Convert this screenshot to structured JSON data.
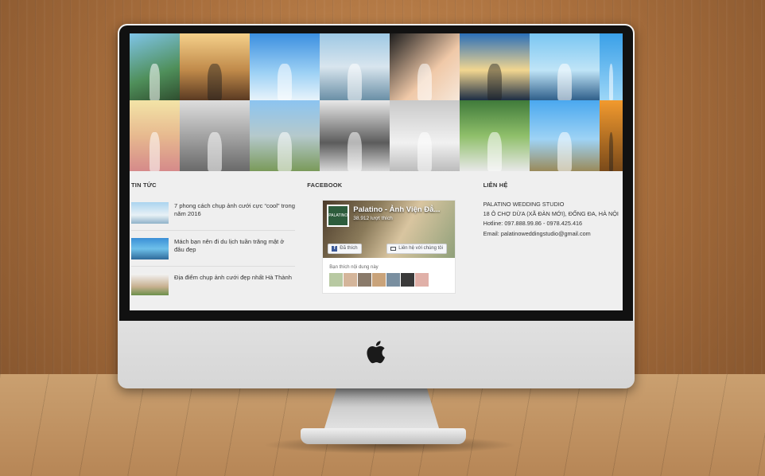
{
  "news": {
    "title": "TIN TỨC",
    "items": [
      {
        "text": "7 phong cách chụp ảnh cưới cực “cool” trong năm 2016"
      },
      {
        "text": "Mách bạn nên đi du lịch tuần trăng mật ở đâu đẹp"
      },
      {
        "text": "Địa điểm chụp ảnh cưới đẹp nhất Hà Thành"
      }
    ]
  },
  "facebook": {
    "title": "FACEBOOK",
    "page_name": "Palatino - Ảnh Viện Đẳ...",
    "logo_text": "PALATINO",
    "likes": "38.912 lượt thích",
    "like_button": "Đã thích",
    "contact_button": "Liên hệ với chúng tôi",
    "friends_label": "Bạn thích nội dung này"
  },
  "contact": {
    "title": "LIÊN HỆ",
    "company": "PALATINO WEDDING STUDIO",
    "address": "18 Ô CHỢ DỪA (XÃ ĐÀN MỚI), ĐỐNG ĐA, HÀ NỘI",
    "hotline": "Hotline: 097.888.99.86 - 0978.425.416",
    "email": "Email: palatinoweddingstudio@gmail.com"
  },
  "icons": {
    "brand": "apple-icon",
    "facebook": "facebook-f-icon",
    "message": "envelope-icon"
  },
  "colors": {
    "screen_bg": "#efefef",
    "facebook_blue": "#3b5998",
    "text": "#333333"
  }
}
